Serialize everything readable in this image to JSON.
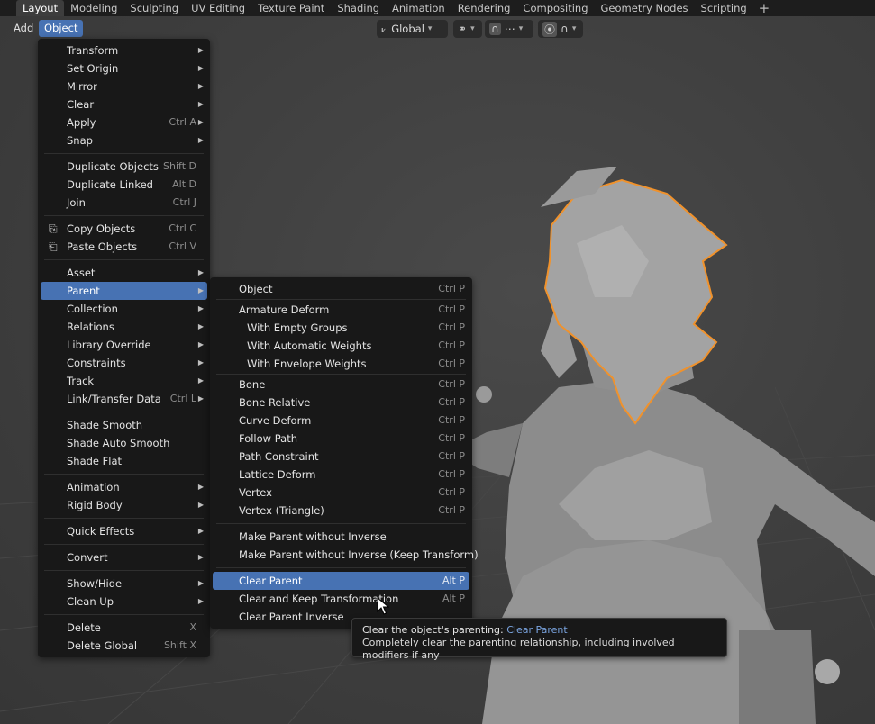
{
  "workspace_tabs": [
    {
      "label": "Layout",
      "active": true
    },
    {
      "label": "Modeling"
    },
    {
      "label": "Sculpting"
    },
    {
      "label": "UV Editing"
    },
    {
      "label": "Texture Paint"
    },
    {
      "label": "Shading"
    },
    {
      "label": "Animation"
    },
    {
      "label": "Rendering"
    },
    {
      "label": "Compositing"
    },
    {
      "label": "Geometry Nodes"
    },
    {
      "label": "Scripting"
    }
  ],
  "workspace_add": "+",
  "header": {
    "add_label": "Add",
    "object_label": "Object",
    "orientation_label": "Global"
  },
  "object_menu": {
    "transform": {
      "label": "Transform"
    },
    "set_origin": {
      "label": "Set Origin"
    },
    "mirror": {
      "label": "Mirror"
    },
    "clear": {
      "label": "Clear"
    },
    "apply": {
      "label": "Apply",
      "shortcut": "Ctrl A"
    },
    "snap": {
      "label": "Snap"
    },
    "duplicate_objects": {
      "label": "Duplicate Objects",
      "shortcut": "Shift D"
    },
    "duplicate_linked": {
      "label": "Duplicate Linked",
      "shortcut": "Alt D"
    },
    "join": {
      "label": "Join",
      "shortcut": "Ctrl J"
    },
    "copy_objects": {
      "label": "Copy Objects",
      "shortcut": "Ctrl C"
    },
    "paste_objects": {
      "label": "Paste Objects",
      "shortcut": "Ctrl V"
    },
    "asset": {
      "label": "Asset"
    },
    "parent": {
      "label": "Parent"
    },
    "collection": {
      "label": "Collection"
    },
    "relations": {
      "label": "Relations"
    },
    "library_override": {
      "label": "Library Override"
    },
    "constraints": {
      "label": "Constraints"
    },
    "track": {
      "label": "Track"
    },
    "link_transfer": {
      "label": "Link/Transfer Data",
      "shortcut": "Ctrl L"
    },
    "shade_smooth": {
      "label": "Shade Smooth"
    },
    "shade_auto_smooth": {
      "label": "Shade Auto Smooth"
    },
    "shade_flat": {
      "label": "Shade Flat"
    },
    "animation": {
      "label": "Animation"
    },
    "rigid_body": {
      "label": "Rigid Body"
    },
    "quick_effects": {
      "label": "Quick Effects"
    },
    "convert": {
      "label": "Convert"
    },
    "show_hide": {
      "label": "Show/Hide"
    },
    "clean_up": {
      "label": "Clean Up"
    },
    "delete": {
      "label": "Delete",
      "shortcut": "X"
    },
    "delete_global": {
      "label": "Delete Global",
      "shortcut": "Shift X"
    }
  },
  "parent_menu": {
    "object": {
      "label": "Object",
      "shortcut": "Ctrl P"
    },
    "armature_deform": {
      "label": "Armature Deform",
      "shortcut": "Ctrl P"
    },
    "with_empty_groups": {
      "label": "With Empty Groups",
      "shortcut": "Ctrl P"
    },
    "with_automatic_weights": {
      "label": "With Automatic Weights",
      "shortcut": "Ctrl P"
    },
    "with_envelope_weights": {
      "label": "With Envelope Weights",
      "shortcut": "Ctrl P"
    },
    "bone": {
      "label": "Bone",
      "shortcut": "Ctrl P"
    },
    "bone_relative": {
      "label": "Bone Relative",
      "shortcut": "Ctrl P"
    },
    "curve_deform": {
      "label": "Curve Deform",
      "shortcut": "Ctrl P"
    },
    "follow_path": {
      "label": "Follow Path",
      "shortcut": "Ctrl P"
    },
    "path_constraint": {
      "label": "Path Constraint",
      "shortcut": "Ctrl P"
    },
    "lattice_deform": {
      "label": "Lattice Deform",
      "shortcut": "Ctrl P"
    },
    "vertex": {
      "label": "Vertex",
      "shortcut": "Ctrl P"
    },
    "vertex_triangle": {
      "label": "Vertex (Triangle)",
      "shortcut": "Ctrl P"
    },
    "make_parent_no_inverse": {
      "label": "Make Parent without Inverse"
    },
    "make_parent_no_inverse_keep": {
      "label": "Make Parent without Inverse (Keep Transform)"
    },
    "clear_parent": {
      "label": "Clear Parent",
      "shortcut": "Alt P"
    },
    "clear_keep_transform": {
      "label": "Clear and Keep Transformation",
      "shortcut": "Alt P"
    },
    "clear_parent_inverse": {
      "label": "Clear Parent Inverse"
    }
  },
  "tooltip": {
    "line1_prefix": "Clear the object's parenting:",
    "line1_op": "Clear Parent",
    "line2": "Completely clear the parenting relationship, including involved modifiers if any"
  },
  "colors": {
    "highlight": "#4772b3",
    "selection_outline": "#f0922c",
    "menu_bg": "#181818"
  }
}
